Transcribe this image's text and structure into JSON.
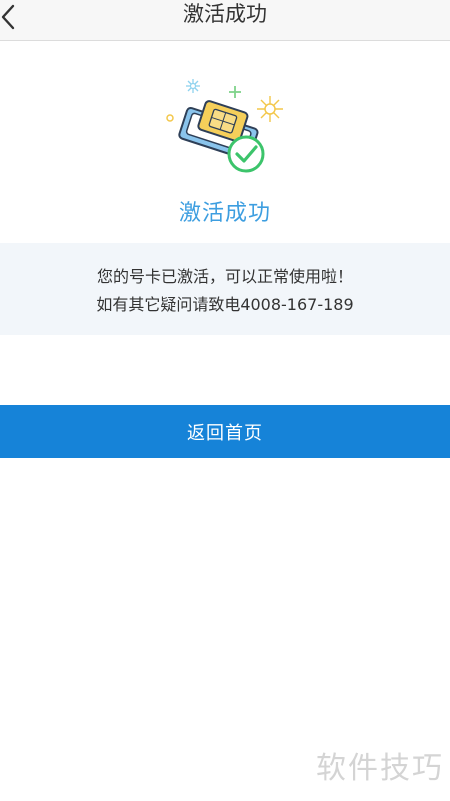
{
  "header": {
    "title": "激活成功",
    "back_icon": "chevron-left-icon"
  },
  "result": {
    "illustration_icon": "sim-card-success-icon",
    "title": "激活成功",
    "message_line1": "您的号卡已激活，可以正常使用啦！",
    "message_line2": "如有其它疑问请致电4008-167-189"
  },
  "actions": {
    "home_button_label": "返回首页"
  },
  "watermark": {
    "text": "软件技巧"
  },
  "colors": {
    "accent_blue": "#1683d8",
    "title_blue": "#3d9ee0",
    "success_green": "#3cc46b",
    "panel_bg": "#f2f6fa"
  }
}
